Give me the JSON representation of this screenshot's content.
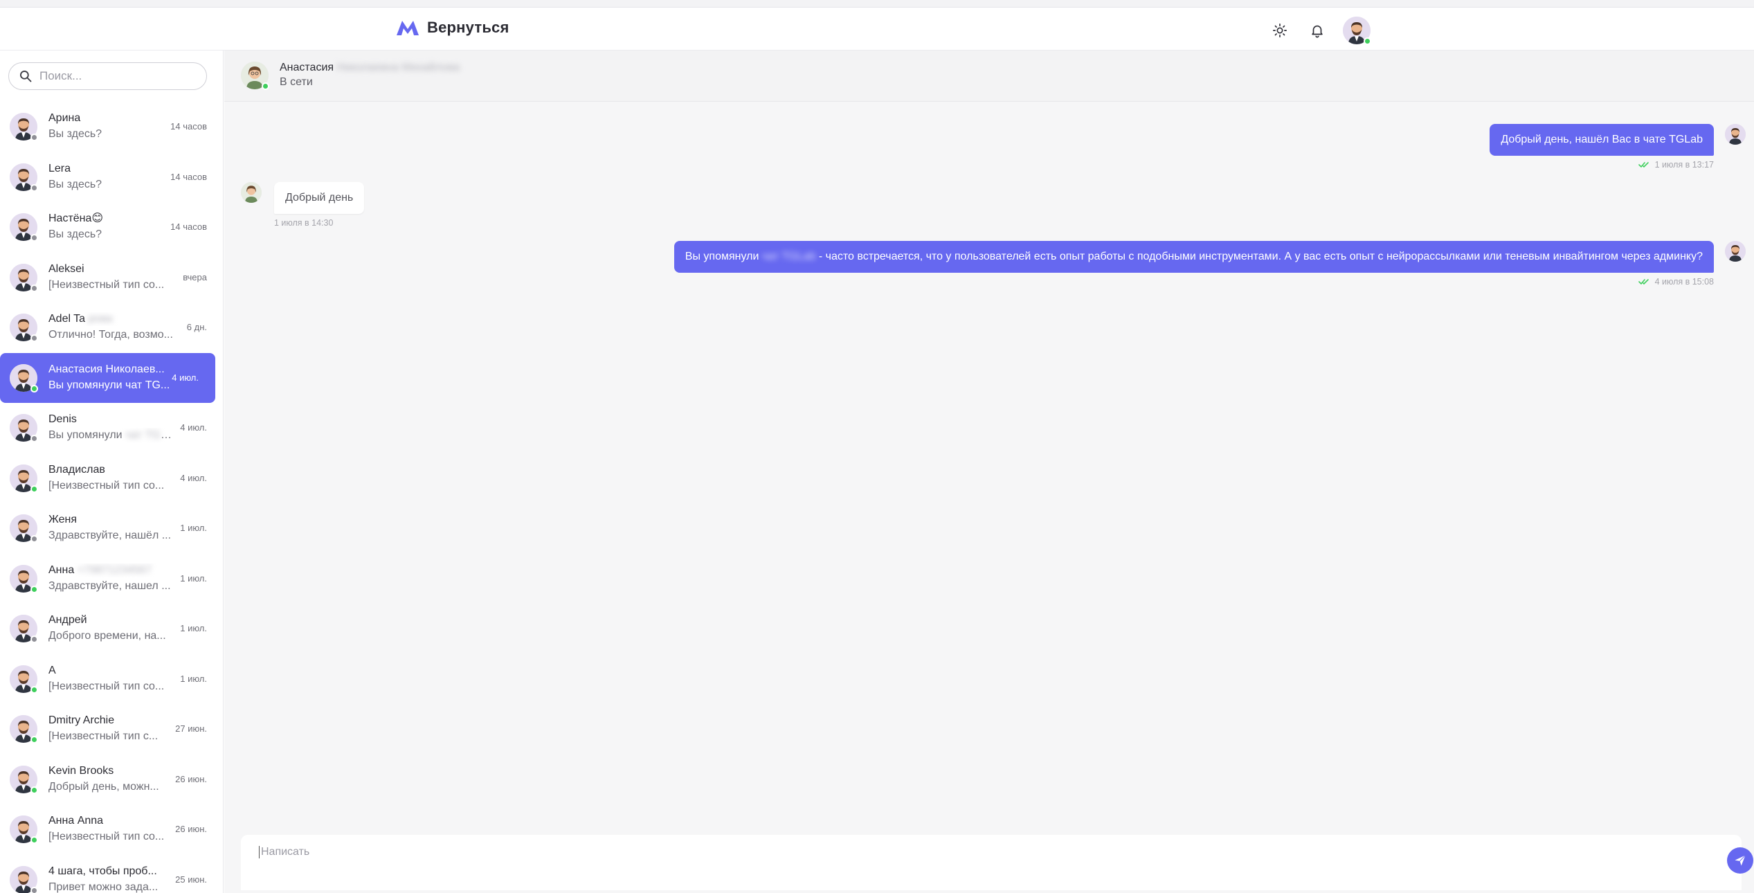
{
  "header": {
    "logo_text": "Вернуться",
    "accent": "#6668f0"
  },
  "search": {
    "placeholder": "Поиск..."
  },
  "chats": [
    {
      "name": "Арина",
      "preview": "Вы здесь?",
      "time": "14 часов",
      "online": false
    },
    {
      "name": "Lera",
      "preview": "Вы здесь?",
      "time": "14 часов",
      "online": false
    },
    {
      "name": "Настёна😊",
      "preview": "Вы здесь?",
      "time": "14 часов",
      "online": false
    },
    {
      "name": "Aleksei",
      "preview": "[Неизвестный тип со...",
      "time": "вчера",
      "online": false
    },
    {
      "name": "Adel Ta",
      "name_blur": "рова",
      "preview": "Отлично! Тогда, возмо...",
      "time": "6 дн.",
      "online": false
    },
    {
      "name": "Анастасия Николаев...",
      "preview": "Вы упомянули чат TG...",
      "time": "4 июл.",
      "online": true,
      "active": true
    },
    {
      "name": "Denis",
      "preview": "Вы упомянули",
      "preview_blur": "чат TGLab",
      "time": "4 июл.",
      "online": false
    },
    {
      "name": "Владислав",
      "preview": "[Неизвестный тип со...",
      "time": "4 июл.",
      "online": true
    },
    {
      "name": "Женя",
      "preview": "Здравствуйте, нашёл ...",
      "time": "1 июл.",
      "online": false
    },
    {
      "name": "Анна",
      "name_blur": "+79871234567",
      "preview": "Здравствуйте, нашел ...",
      "time": "1 июл.",
      "online": true
    },
    {
      "name": "Андрей",
      "preview": "Доброго времени, на...",
      "time": "1 июл.",
      "online": false
    },
    {
      "name": "А",
      "preview": "[Неизвестный тип со...",
      "time": "1 июл.",
      "online": true
    },
    {
      "name": "Dmitry Archie",
      "preview": "[Неизвестный тип с...",
      "time": "27 июн.",
      "online": true
    },
    {
      "name": "Kevin Brooks",
      "preview": "Добрый день, можн...",
      "time": "26 июн.",
      "online": true
    },
    {
      "name": "Анна Anna",
      "preview": "[Неизвестный тип со...",
      "time": "26 июн.",
      "online": true
    },
    {
      "name": "4 шага, чтобы проб...",
      "preview": "Привет можно зада...",
      "time": "25 июн.",
      "online": false
    }
  ],
  "conversation": {
    "name": "Анастасия",
    "name_blur": "Николаевна Михайлова",
    "status": "В сети",
    "messages": [
      {
        "direction": "out",
        "text": "Добрый день, нашёл Вас в чате TGLab",
        "time": "1 июля в 13:17"
      },
      {
        "direction": "in",
        "text": "Добрый день",
        "time": "1 июля в 14:30"
      },
      {
        "direction": "out",
        "text_before": "Вы упомянули",
        "text_blur": "чат TGLab",
        "text_after": "- часто встречается, что у пользователей есть опыт работы с подобными инструментами. А у вас есть опыт с нейрорассылками или теневым инвайтингом через админку?",
        "time": "4 июля в 15:08"
      }
    ]
  },
  "composer": {
    "placeholder": "Написать"
  }
}
